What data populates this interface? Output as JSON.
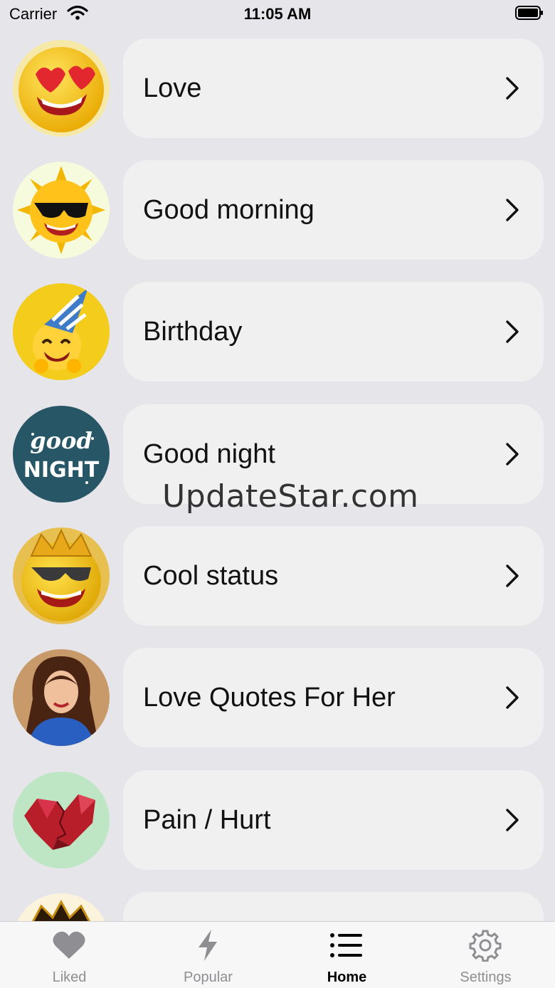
{
  "status_bar": {
    "carrier": "Carrier",
    "time": "11:05 AM"
  },
  "categories": [
    {
      "label": "Love",
      "icon": "heart-eyes-emoji-icon"
    },
    {
      "label": "Good morning",
      "icon": "sun-sunglasses-emoji-icon"
    },
    {
      "label": "Birthday",
      "icon": "party-hat-emoji-icon"
    },
    {
      "label": "Good night",
      "icon": "good-night-badge-icon",
      "badge_text": "good NIGHT"
    },
    {
      "label": "Cool status",
      "icon": "crown-sunglasses-emoji-icon"
    },
    {
      "label": "Love Quotes For Her",
      "icon": "woman-portrait-icon"
    },
    {
      "label": "Pain / Hurt",
      "icon": "broken-heart-icon"
    }
  ],
  "watermark": "UpdateStar.com",
  "tabbar": {
    "tabs": [
      {
        "label": "Liked",
        "icon": "heart-icon",
        "active": false
      },
      {
        "label": "Popular",
        "icon": "bolt-icon",
        "active": false
      },
      {
        "label": "Home",
        "icon": "list-icon",
        "active": true
      },
      {
        "label": "Settings",
        "icon": "gear-icon",
        "active": false
      }
    ]
  },
  "colors": {
    "background": "#e5e5ea",
    "card": "#f0f0f0",
    "inactive_tab": "#8e8e93",
    "active_tab": "#000000"
  }
}
